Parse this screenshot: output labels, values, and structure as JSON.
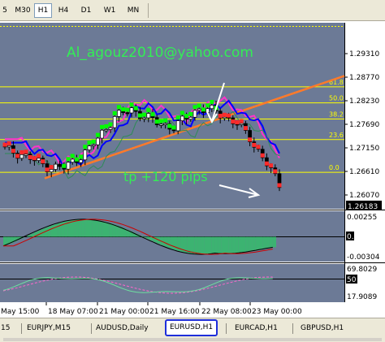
{
  "toolbar": {
    "timeframes": [
      {
        "label": "5",
        "active": false
      },
      {
        "label": "M30",
        "active": false
      },
      {
        "label": "H1",
        "active": true
      },
      {
        "label": "H4",
        "active": false
      },
      {
        "label": "D1",
        "active": false
      },
      {
        "label": "W1",
        "active": false
      },
      {
        "label": "MN",
        "active": false
      }
    ]
  },
  "chart": {
    "watermark": "Al_agouz2010@yahoo.com",
    "annotation": "tp +120 pips",
    "fib_levels": [
      {
        "label": "61.8",
        "price": 1.2855
      },
      {
        "label": "50.0",
        "price": 1.2818
      },
      {
        "label": "38.2",
        "price": 1.2781
      },
      {
        "label": "23.6",
        "price": 1.2734
      },
      {
        "label": "0.0",
        "price": 1.2659
      }
    ],
    "price_axis": [
      "1.29310",
      "1.28770",
      "1.28230",
      "1.27690",
      "1.27150",
      "1.26610",
      "1.26070"
    ],
    "current_price": "1.26183",
    "colors": {
      "background": "#6c7a96",
      "bull_candle": "#00ff00",
      "bear_candle": "#ff2a2a",
      "fib": "#ffff00",
      "trendline": "#ff7a2a",
      "ma_blue": "#0000ff",
      "ma_magenta": "#ff33cc",
      "ma_red": "#ff0000",
      "macd_hist": "#3cb371"
    },
    "macd_panel": {
      "values": [
        "0.00255",
        "0.00",
        "-0.00304"
      ]
    },
    "osc_panel": {
      "values": [
        "69.8029",
        "50",
        "17.9089"
      ]
    },
    "time_axis": [
      "May 15:00",
      "18 May 07:00",
      "21 May 00:00",
      "21 May 16:00",
      "22 May 08:00",
      "23 May 00:00"
    ]
  },
  "tabs": [
    {
      "label": "15",
      "active": false
    },
    {
      "label": "EURJPY,M15",
      "active": false
    },
    {
      "label": "AUDUSD,Daily",
      "active": false
    },
    {
      "label": "EURUSD,H1",
      "active": true
    },
    {
      "label": "EURCAD,H1",
      "active": false
    },
    {
      "label": "GBPUSD,H1",
      "active": false
    }
  ]
}
